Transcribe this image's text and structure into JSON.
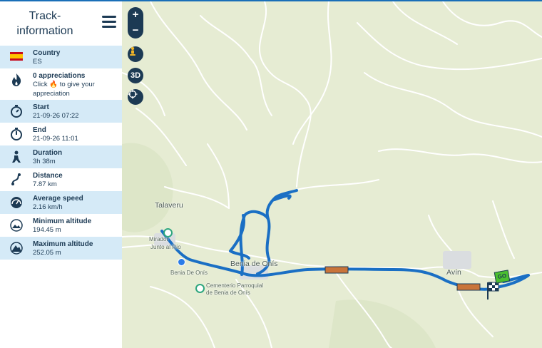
{
  "sidebar": {
    "title": "Track-information",
    "country": {
      "label": "Country",
      "value": "ES"
    },
    "appreciations": {
      "label": "0 appreciations",
      "hint": "Click 🔥 to give your appreciation"
    },
    "start": {
      "label": "Start",
      "value": "21-09-26 07:22"
    },
    "end": {
      "label": "End",
      "value": "21-09-26 11:01"
    },
    "duration": {
      "label": "Duration",
      "value": "3h 38m"
    },
    "distance": {
      "label": "Distance",
      "value": "7.87 km"
    },
    "avg_speed": {
      "label": "Average speed",
      "value": "2.16 km/h"
    },
    "min_alt": {
      "label": "Minimum altitude",
      "value": "194.45 m"
    },
    "max_alt": {
      "label": "Maximum altitude",
      "value": "252.05 m"
    }
  },
  "map_controls": {
    "zoom_in": "+",
    "zoom_out": "−",
    "view_3d": "3D"
  },
  "map_labels": {
    "talaveru": "Talaveru",
    "mirador": "Mirador",
    "junto_al_rio": "Junto al Río",
    "benia_de_onis_small": "Benia De Onís",
    "benia_de_onis": "Benia de Onís",
    "cementerio_1": "Cementerio Parroquial",
    "cementerio_2": "de Benia de Onís",
    "avin": "Avín",
    "go_marker": "GO"
  },
  "colors": {
    "track": "#1a6fc4",
    "sidebar_text": "#1c3a54",
    "row_highlight": "#d5eaf7",
    "map_bg": "#e6ecd3"
  }
}
